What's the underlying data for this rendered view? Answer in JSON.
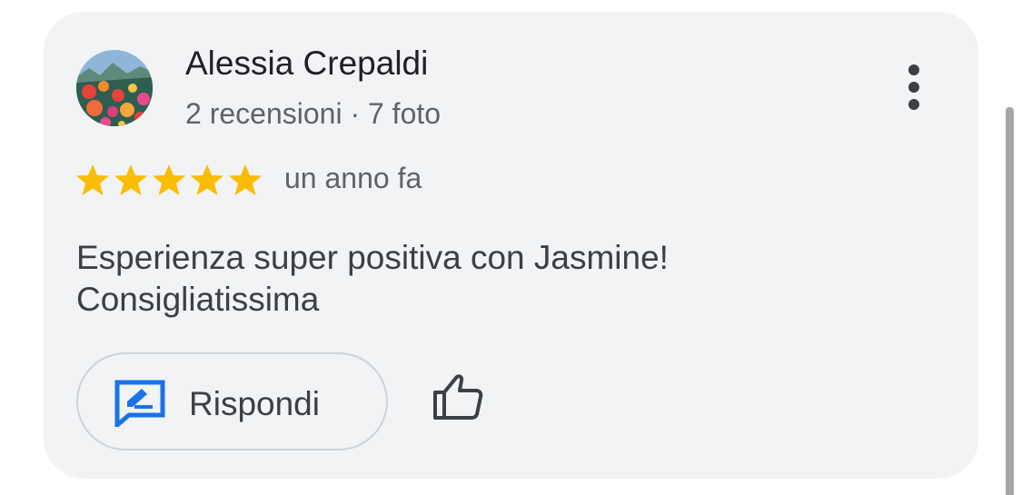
{
  "review": {
    "author_name": "Alessia Crepaldi",
    "author_meta": "2 recensioni · 7 foto",
    "rating": 5,
    "rating_max": 5,
    "date": "un anno fa",
    "text_line1": "Esperienza super positiva con Jasmine!",
    "text_line2": "Consigliatissima"
  },
  "actions": {
    "reply_label": "Rispondi",
    "reply_icon": "reply-edit-icon",
    "like_icon": "thumb-up-icon",
    "more_icon": "more-vert-icon"
  },
  "colors": {
    "card_background": "#f1f3f4",
    "star": "#fbbc04",
    "reply_icon": "#1a73e8",
    "text_primary": "#202124",
    "text_secondary": "#5f6368"
  }
}
